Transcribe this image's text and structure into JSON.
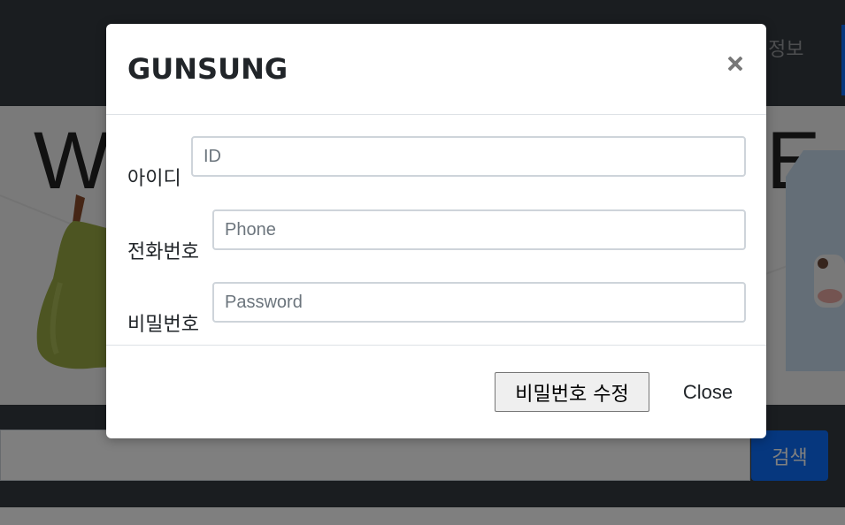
{
  "nav": {
    "info_link": "정보"
  },
  "hero": {
    "title_left": "W",
    "title_right": "E"
  },
  "search": {
    "button_label": "검색"
  },
  "modal": {
    "title": "GUNSUNG",
    "fields": [
      {
        "label": "아이디",
        "placeholder": "ID"
      },
      {
        "label": "전화번호",
        "placeholder": "Phone"
      },
      {
        "label": "비밀번호",
        "placeholder": "Password"
      }
    ],
    "submit_label": "비밀번호 수정",
    "close_label": "Close"
  },
  "colors": {
    "navbar": "#343a40",
    "primary": "#0d6efd",
    "backdrop": "rgba(0,0,0,0.5)"
  }
}
